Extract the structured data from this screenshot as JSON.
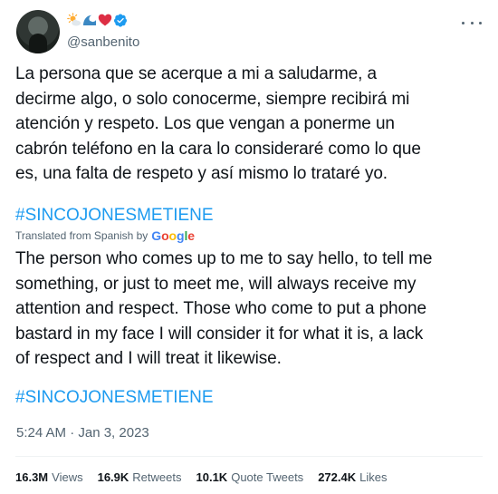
{
  "header": {
    "handle": "@sanbenito",
    "emojis": [
      "sun-behind-cloud-icon",
      "water-wave-icon",
      "red-heart-icon",
      "verified-badge-icon"
    ]
  },
  "tweet": {
    "original_text": "La persona que se acerque a mi a saludarme, a\ndecirme algo, o solo conocerme, siempre recibirá mi\natención y respeto. Los que vengan a ponerme un\ncabrón teléfono en la cara lo consideraré como lo que\nes, una falta de respeto y así mismo lo trataré yo.",
    "hashtag": "#SINCOJONESMETIENE",
    "translated_label": "Translated from Spanish by",
    "google_letters": [
      "G",
      "o",
      "o",
      "g",
      "l",
      "e"
    ],
    "translated_text": "The person who comes up to me to say hello, to tell me\nsomething, or just to meet me, will always receive my\nattention and respect. Those who come to put a phone\nbastard in my face I will consider it for what it is, a lack\nof respect and I will treat it likewise.",
    "hashtag_translated": "#SINCOJONESMETIENE",
    "timestamp": "5:24 AM · Jan 3, 2023"
  },
  "stats": {
    "views_count": "16.3M",
    "views_label": "Views",
    "retweets_count": "16.9K",
    "retweets_label": "Retweets",
    "quotes_count": "10.1K",
    "quotes_label": "Quote Tweets",
    "likes_count": "272.4K",
    "likes_label": "Likes"
  },
  "colors": {
    "link": "#1d9bf0",
    "secondary_text": "#536471",
    "primary_text": "#0f1419",
    "verified": "#1d9bf0"
  }
}
